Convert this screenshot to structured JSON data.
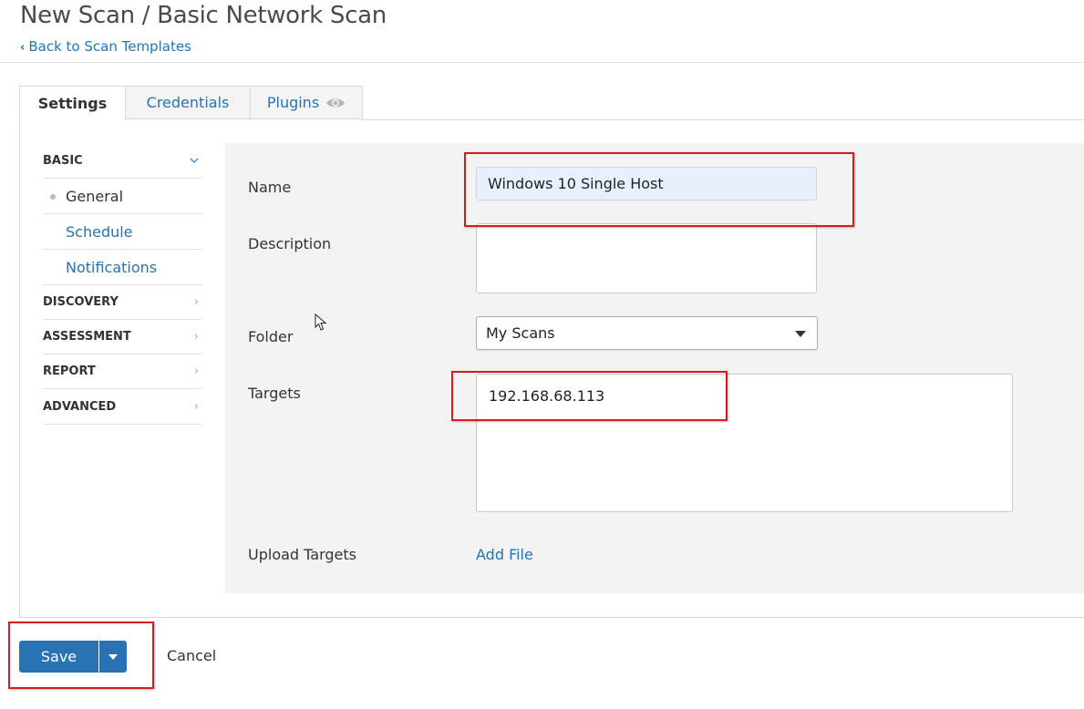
{
  "header": {
    "title": "New Scan / Basic Network Scan",
    "back_link": "Back to Scan Templates"
  },
  "tabs": [
    {
      "label": "Settings",
      "active": true
    },
    {
      "label": "Credentials",
      "active": false
    },
    {
      "label": "Plugins",
      "active": false,
      "icon": "eye-icon"
    }
  ],
  "sidebar": {
    "sections": [
      {
        "label": "BASIC",
        "expanded": true,
        "items": [
          {
            "label": "General",
            "current": true
          },
          {
            "label": "Schedule",
            "current": false
          },
          {
            "label": "Notifications",
            "current": false
          }
        ]
      },
      {
        "label": "DISCOVERY",
        "expanded": false
      },
      {
        "label": "ASSESSMENT",
        "expanded": false
      },
      {
        "label": "REPORT",
        "expanded": false
      },
      {
        "label": "ADVANCED",
        "expanded": false
      }
    ]
  },
  "form": {
    "name": {
      "label": "Name",
      "value": "Windows 10 Single Host"
    },
    "description": {
      "label": "Description",
      "value": ""
    },
    "folder": {
      "label": "Folder",
      "value": "My Scans"
    },
    "targets": {
      "label": "Targets",
      "value": "192.168.68.113"
    },
    "upload": {
      "label": "Upload Targets",
      "link": "Add File"
    }
  },
  "footer": {
    "save_label": "Save",
    "cancel_label": "Cancel"
  },
  "colors": {
    "accent": "#2773b3",
    "highlight": "#d71920",
    "autofill_bg": "#e8f0fe"
  }
}
